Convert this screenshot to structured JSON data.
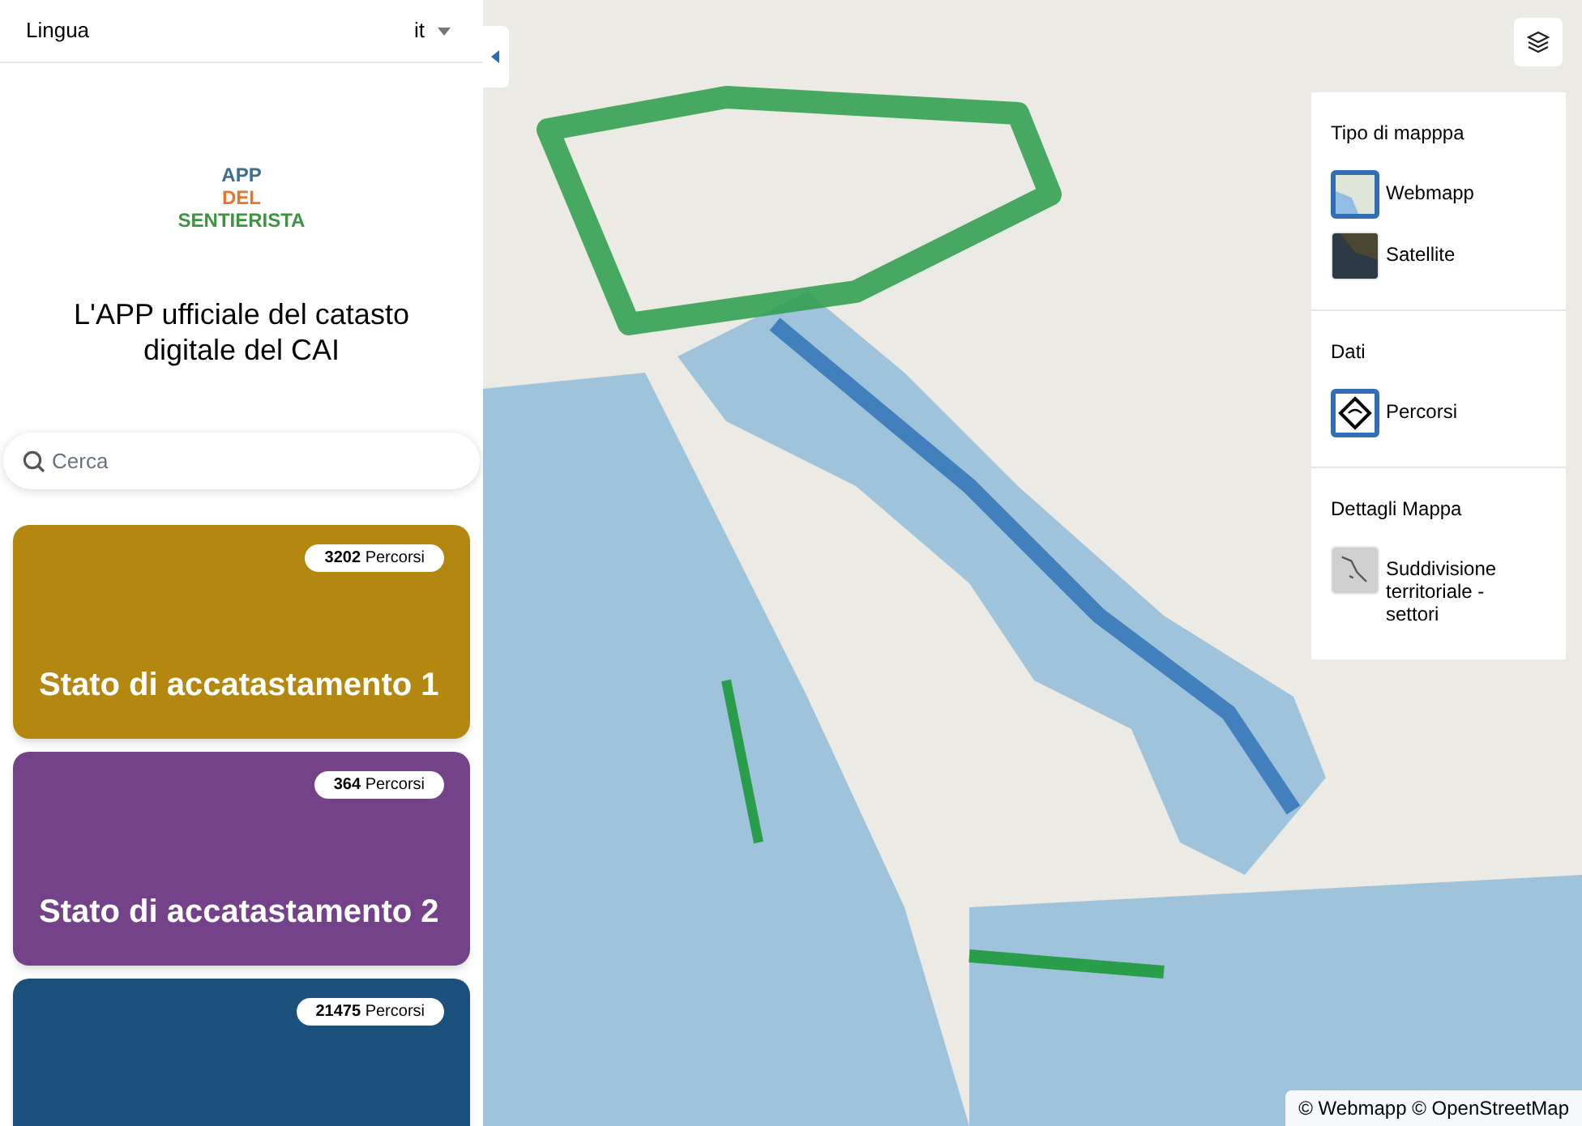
{
  "language": {
    "label": "Lingua",
    "value": "it"
  },
  "logo": [
    "APP",
    "DEL",
    "SENTIERISTA"
  ],
  "tagline": "L'APP ufficiale del catasto digitale del CAI",
  "search": {
    "placeholder": "Cerca"
  },
  "cards": [
    {
      "count": "**3202** Percorsi",
      "title": "Stato di accatastamento 1",
      "color": "#b38710"
    },
    {
      "count": "**364** Percorsi",
      "title": "Stato di accatastamento 2",
      "color": "#744288"
    },
    {
      "count": "**21475** Percorsi",
      "color": "#1b4f7c"
    }
  ],
  "layers": {
    "sections": [
      {
        "title": "Tipo di mapppa",
        "items": [
          {
            "label": "Webmapp",
            "kind": "map",
            "selected": true
          },
          {
            "label": "Satellite",
            "kind": "satellite",
            "selected": false
          }
        ]
      },
      {
        "title": "Dati",
        "items": [
          {
            "label": "Percorsi",
            "kind": "trail",
            "selected": true
          }
        ]
      },
      {
        "title": "Dettagli Mappa",
        "items": [
          {
            "label": "Suddivisione territoriale - settori",
            "kind": "sectors",
            "selected": false
          }
        ]
      }
    ]
  },
  "attribution": "© Webmapp © OpenStreetMap"
}
